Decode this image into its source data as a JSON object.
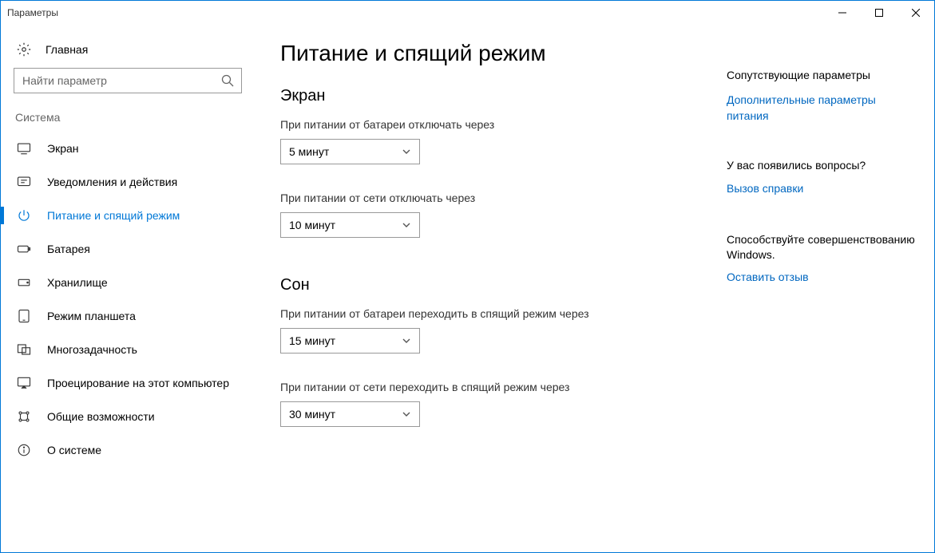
{
  "window": {
    "title": "Параметры"
  },
  "sidebar": {
    "home": "Главная",
    "searchPlaceholder": "Найти параметр",
    "section": "Система",
    "items": [
      {
        "label": "Экран"
      },
      {
        "label": "Уведомления и действия"
      },
      {
        "label": "Питание и спящий режим"
      },
      {
        "label": "Батарея"
      },
      {
        "label": "Хранилище"
      },
      {
        "label": "Режим планшета"
      },
      {
        "label": "Многозадачность"
      },
      {
        "label": "Проецирование на этот компьютер"
      },
      {
        "label": "Общие возможности"
      },
      {
        "label": "О системе"
      }
    ]
  },
  "main": {
    "title": "Питание и спящий режим",
    "screen": {
      "heading": "Экран",
      "battery": {
        "label": "При питании от батареи отключать через",
        "value": "5 минут"
      },
      "plugged": {
        "label": "При питании от сети отключать через",
        "value": "10 минут"
      }
    },
    "sleep": {
      "heading": "Сон",
      "battery": {
        "label": "При питании от батареи переходить в спящий режим через",
        "value": "15 минут"
      },
      "plugged": {
        "label": "При питании от сети переходить в спящий режим через",
        "value": "30 минут"
      }
    }
  },
  "aside": {
    "relatedTitle": "Сопутствующие параметры",
    "relatedLink": "Дополнительные параметры питания",
    "helpTitle": "У вас появились вопросы?",
    "helpLink": "Вызов справки",
    "feedbackTitle": "Способствуйте совершенствованию Windows.",
    "feedbackLink": "Оставить отзыв"
  }
}
